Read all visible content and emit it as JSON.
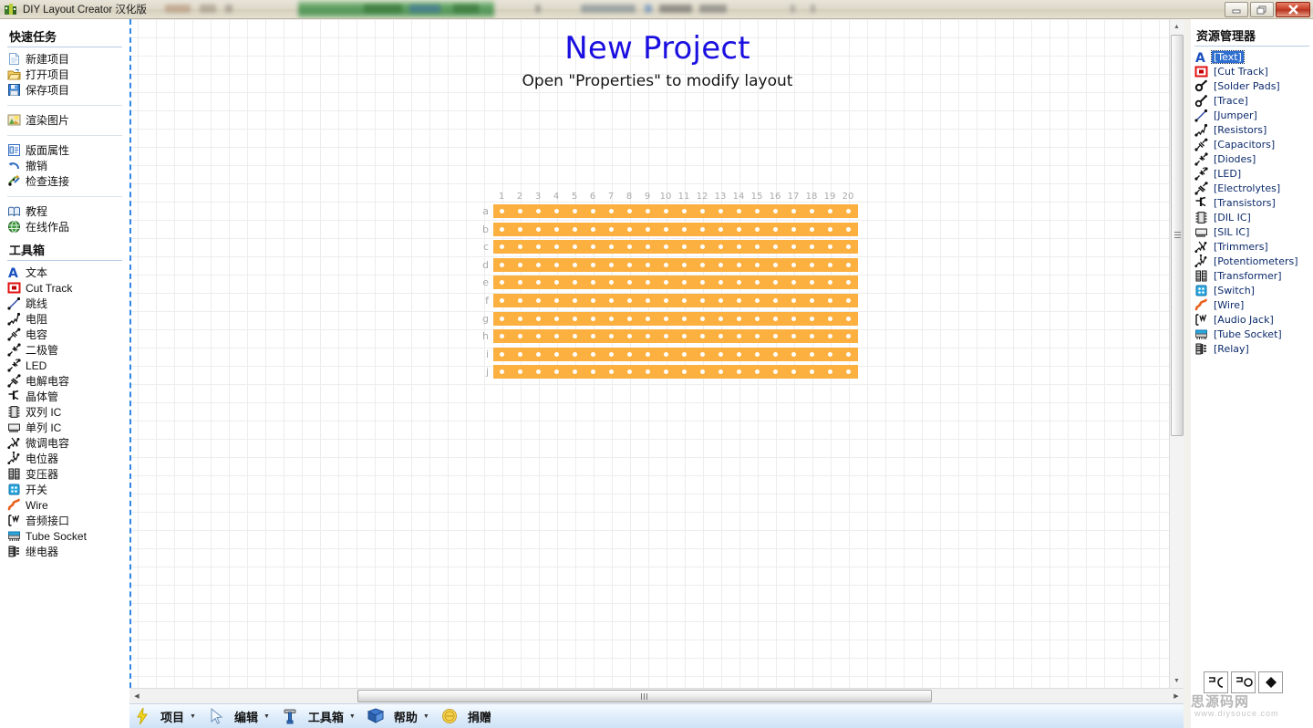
{
  "window": {
    "title": "DIY Layout Creator 汉化版",
    "app_icon": "diylc-icon",
    "controls": [
      {
        "name": "minimize-button",
        "glyph": "—"
      },
      {
        "name": "restore-button",
        "glyph": "❐"
      },
      {
        "name": "close-button",
        "glyph": "✕"
      }
    ]
  },
  "sidebar": {
    "section_quick": {
      "title": "快速任务",
      "items": [
        {
          "label": "新建项目",
          "icon": "new-document-icon"
        },
        {
          "label": "打开项目",
          "icon": "open-folder-icon"
        },
        {
          "label": "保存项目",
          "icon": "save-disk-icon"
        }
      ]
    },
    "section_render": {
      "items": [
        {
          "label": "渲染图片",
          "icon": "render-image-icon"
        }
      ]
    },
    "section_board": {
      "items": [
        {
          "label": "版面属性",
          "icon": "layout-properties-icon"
        },
        {
          "label": "撤销",
          "icon": "undo-arrow-icon"
        },
        {
          "label": "检查连接",
          "icon": "check-connections-icon"
        }
      ]
    },
    "section_help": {
      "items": [
        {
          "label": "教程",
          "icon": "book-tutorial-icon"
        },
        {
          "label": "在线作品",
          "icon": "globe-online-icon"
        }
      ]
    },
    "section_toolbox": {
      "title": "工具箱",
      "items": [
        {
          "label": "文本",
          "icon": "text-a-icon"
        },
        {
          "label": "Cut Track",
          "icon": "cut-track-icon"
        },
        {
          "label": "跳线",
          "icon": "jumper-icon"
        },
        {
          "label": "电阻",
          "icon": "resistor-icon"
        },
        {
          "label": "电容",
          "icon": "capacitor-icon"
        },
        {
          "label": "二极管",
          "icon": "diode-icon"
        },
        {
          "label": "LED",
          "icon": "led-icon"
        },
        {
          "label": "电解电容",
          "icon": "electrolytic-cap-icon"
        },
        {
          "label": "晶体管",
          "icon": "transistor-icon"
        },
        {
          "label": "双列 IC",
          "icon": "dil-ic-icon"
        },
        {
          "label": "单列 IC",
          "icon": "sil-ic-icon"
        },
        {
          "label": "微调电容",
          "icon": "trimmer-icon"
        },
        {
          "label": "电位器",
          "icon": "potentiometer-icon"
        },
        {
          "label": "变压器",
          "icon": "transformer-icon"
        },
        {
          "label": "开关",
          "icon": "switch-icon"
        },
        {
          "label": "Wire",
          "icon": "wire-icon"
        },
        {
          "label": "音频接口",
          "icon": "audio-jack-icon"
        },
        {
          "label": "Tube Socket",
          "icon": "tube-socket-icon"
        },
        {
          "label": "继电器",
          "icon": "relay-icon"
        }
      ]
    }
  },
  "canvas": {
    "project_title": "New Project",
    "project_subtitle": "Open \"Properties\" to modify layout",
    "board": {
      "column_labels": [
        "1",
        "2",
        "3",
        "4",
        "5",
        "6",
        "7",
        "8",
        "9",
        "10",
        "11",
        "12",
        "13",
        "14",
        "15",
        "16",
        "17",
        "18",
        "19",
        "20"
      ],
      "row_labels": [
        "a",
        "b",
        "c",
        "d",
        "e",
        "f",
        "g",
        "h",
        "i",
        "j"
      ],
      "strip_color": "#fbb040",
      "hole_color": "#ffffff",
      "columns": 20,
      "rows": 10
    }
  },
  "menubar": {
    "items": [
      {
        "label": "项目",
        "icon": "lightning-icon",
        "has_caret": true
      },
      {
        "label": "编辑",
        "icon": "cursor-arrow-icon",
        "has_caret": true
      },
      {
        "label": "工具箱",
        "icon": "hammer-icon",
        "has_caret": true
      },
      {
        "label": "帮助",
        "icon": "blue-book-icon",
        "has_caret": true
      },
      {
        "label": "捐赠",
        "icon": "coin-icon",
        "has_caret": false
      }
    ]
  },
  "right_panel": {
    "title": "资源管理器",
    "items": [
      {
        "label": "[Text]",
        "icon": "text-a-icon",
        "selected": true
      },
      {
        "label": "[Cut Track]",
        "icon": "cut-track-icon",
        "selected": false
      },
      {
        "label": "[Solder Pads]",
        "icon": "solder-pad-icon",
        "selected": false
      },
      {
        "label": "[Trace]",
        "icon": "trace-icon",
        "selected": false
      },
      {
        "label": "[Jumper]",
        "icon": "jumper-icon",
        "selected": false
      },
      {
        "label": "[Resistors]",
        "icon": "resistor-icon",
        "selected": false
      },
      {
        "label": "[Capacitors]",
        "icon": "capacitor-icon",
        "selected": false
      },
      {
        "label": "[Diodes]",
        "icon": "diode-icon",
        "selected": false
      },
      {
        "label": "[LED]",
        "icon": "led-icon",
        "selected": false
      },
      {
        "label": "[Electrolytes]",
        "icon": "electrolytic-cap-icon",
        "selected": false
      },
      {
        "label": "[Transistors]",
        "icon": "transistor-icon",
        "selected": false
      },
      {
        "label": "[DIL IC]",
        "icon": "dil-ic-icon",
        "selected": false
      },
      {
        "label": "[SIL IC]",
        "icon": "sil-ic-icon",
        "selected": false
      },
      {
        "label": "[Trimmers]",
        "icon": "trimmer-icon",
        "selected": false
      },
      {
        "label": "[Potentiometers]",
        "icon": "potentiometer-icon",
        "selected": false
      },
      {
        "label": "[Transformer]",
        "icon": "transformer-icon",
        "selected": false
      },
      {
        "label": "[Switch]",
        "icon": "switch-icon",
        "selected": false
      },
      {
        "label": "[Wire]",
        "icon": "wire-icon",
        "selected": false
      },
      {
        "label": "[Audio Jack]",
        "icon": "audio-jack-icon",
        "selected": false
      },
      {
        "label": "[Tube Socket]",
        "icon": "tube-socket-icon",
        "selected": false
      },
      {
        "label": "[Relay]",
        "icon": "relay-icon",
        "selected": false
      }
    ]
  },
  "corner_tools": [
    {
      "name": "align-left-tool",
      "icon": "bracket-left-icon"
    },
    {
      "name": "align-center-tool",
      "icon": "bracket-circle-icon"
    },
    {
      "name": "diamond-tool",
      "icon": "diamond-icon"
    }
  ],
  "watermark": {
    "text": "思源码网",
    "subtext": "www.diysouce.com"
  },
  "scrollbars": {
    "vertical_arrow_up": "▲",
    "vertical_arrow_down": "▼",
    "horizontal_arrow_left": "◀",
    "horizontal_arrow_right": "▶"
  }
}
